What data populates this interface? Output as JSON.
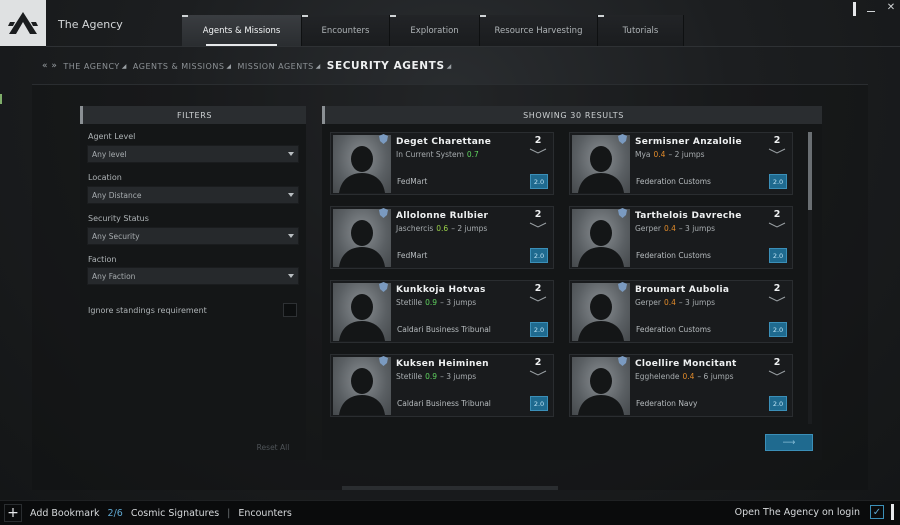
{
  "app": {
    "title": "The Agency"
  },
  "tabs": [
    {
      "label": "Agents & Missions",
      "active": true
    },
    {
      "label": "Encounters",
      "active": false
    },
    {
      "label": "Exploration",
      "active": false
    },
    {
      "label": "Resource Harvesting",
      "active": false
    },
    {
      "label": "Tutorials",
      "active": false
    }
  ],
  "breadcrumb": {
    "arrows": "« »",
    "items": [
      "THE AGENCY",
      "AGENTS & MISSIONS",
      "MISSION AGENTS"
    ],
    "current": "SECURITY AGENTS"
  },
  "filters": {
    "title": "FILTERS",
    "agent_level": {
      "label": "Agent Level",
      "value": "Any level"
    },
    "location": {
      "label": "Location",
      "value": "Any Distance"
    },
    "security_status": {
      "label": "Security Status",
      "value": "Any Security"
    },
    "faction": {
      "label": "Faction",
      "value": "Any Faction"
    },
    "ignore_standings": {
      "label": "Ignore standings requirement",
      "checked": false
    },
    "reset_label": "Reset All"
  },
  "results": {
    "title": "SHOWING 30 RESULTS",
    "agents": [
      {
        "name": "Deget Charettane",
        "system": "In Current System",
        "security": "0.7",
        "sec_color": "#5fd35f",
        "jumps": "",
        "corp": "FedMart",
        "level": "2",
        "standing": "2.0"
      },
      {
        "name": "Sermisner Anzalolie",
        "system": "Mya",
        "security": "0.4",
        "sec_color": "#e08a2a",
        "jumps": "2 jumps",
        "corp": "Federation Customs",
        "level": "2",
        "standing": "2.0"
      },
      {
        "name": "Allolonne Rulbier",
        "system": "Jaschercis",
        "security": "0.6",
        "sec_color": "#9bd34a",
        "jumps": "2 jumps",
        "corp": "FedMart",
        "level": "2",
        "standing": "2.0"
      },
      {
        "name": "Tarthelois Davreche",
        "system": "Gerper",
        "security": "0.4",
        "sec_color": "#e08a2a",
        "jumps": "3 jumps",
        "corp": "Federation Customs",
        "level": "2",
        "standing": "2.0"
      },
      {
        "name": "Kunkkoja Hotvas",
        "system": "Stetille",
        "security": "0.9",
        "sec_color": "#5fd35f",
        "jumps": "3 jumps",
        "corp": "Caldari Business Tribunal",
        "level": "2",
        "standing": "2.0"
      },
      {
        "name": "Broumart Aubolia",
        "system": "Gerper",
        "security": "0.4",
        "sec_color": "#e08a2a",
        "jumps": "3 jumps",
        "corp": "Federation Customs",
        "level": "2",
        "standing": "2.0"
      },
      {
        "name": "Kuksen Heiminen",
        "system": "Stetille",
        "security": "0.9",
        "sec_color": "#5fd35f",
        "jumps": "3 jumps",
        "corp": "Caldari Business Tribunal",
        "level": "2",
        "standing": "2.0"
      },
      {
        "name": "Cloellire Moncitant",
        "system": "Egghelende",
        "security": "0.4",
        "sec_color": "#e08a2a",
        "jumps": "6 jumps",
        "corp": "Federation Navy",
        "level": "2",
        "standing": "2.0"
      }
    ]
  },
  "bottombar": {
    "add_bookmark": "Add Bookmark",
    "count": "2/6",
    "cosmic": "Cosmic Signatures",
    "sep": "|",
    "encounters": "Encounters",
    "open_on_login": "Open The Agency on login"
  },
  "colors": {
    "accent_blue": "#1f6a8f",
    "sec_high": "#5fd35f",
    "sec_low": "#e08a2a"
  }
}
